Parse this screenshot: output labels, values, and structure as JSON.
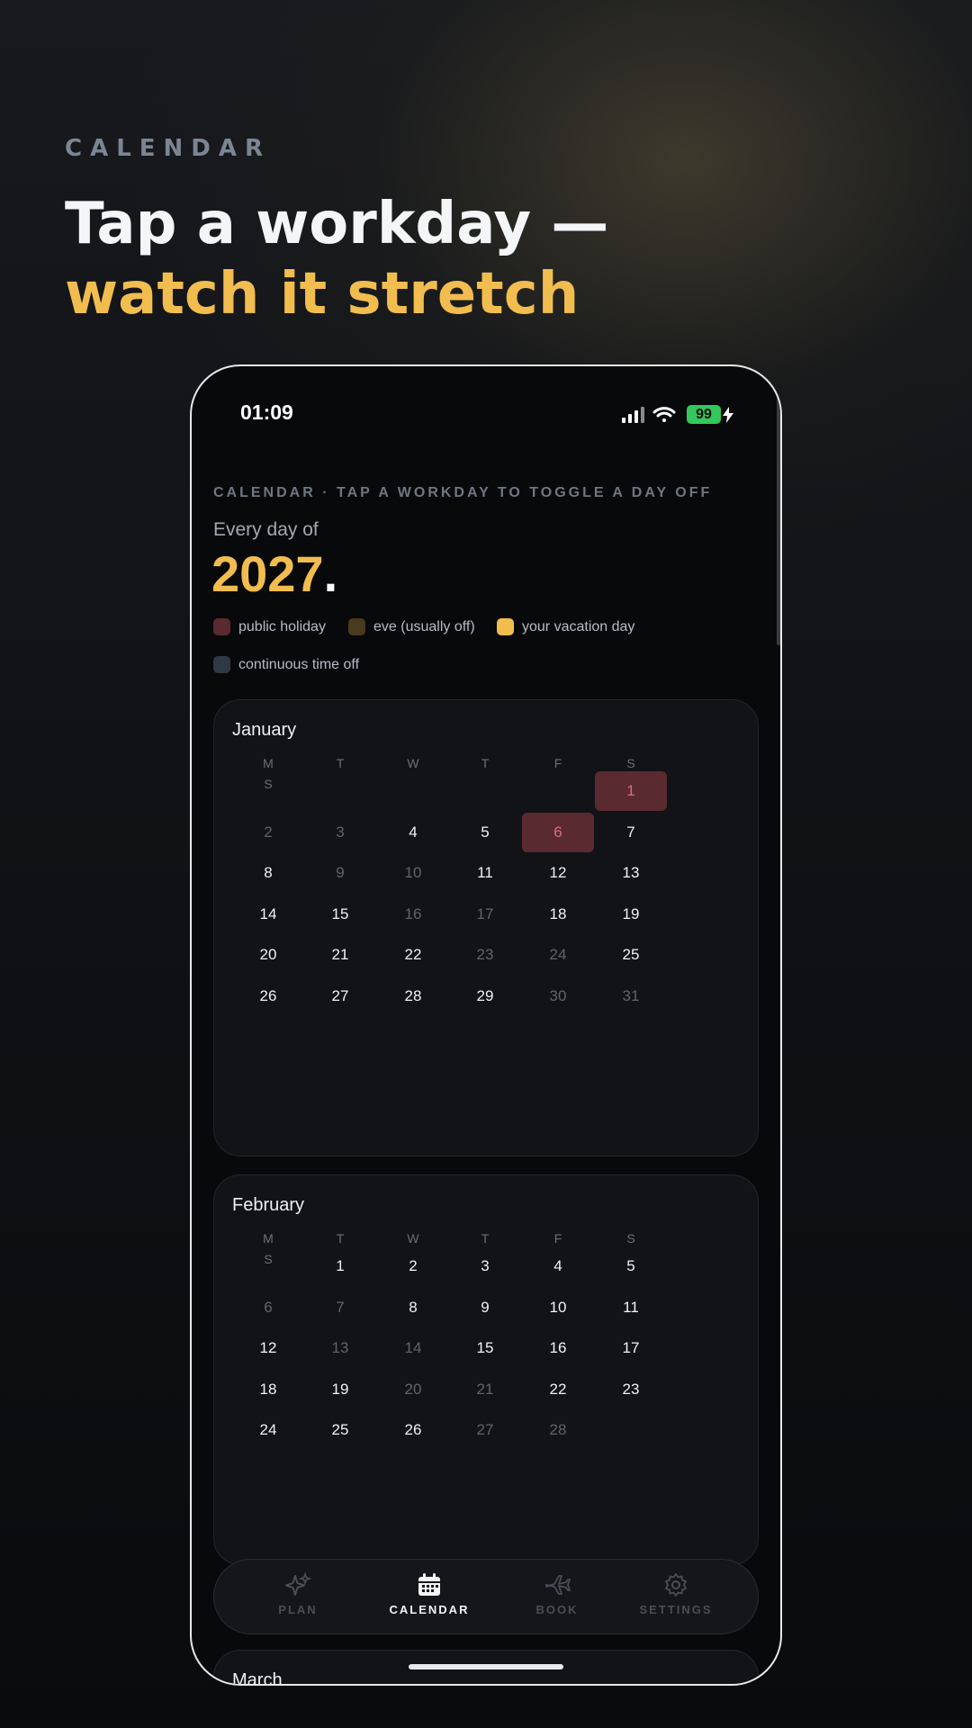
{
  "hero": {
    "eyebrow": "CALENDAR",
    "title_line1": "Tap a workday —",
    "title_line2": "watch it stretch"
  },
  "status_bar": {
    "time": "01:09",
    "battery": "99",
    "icons": [
      "signal-icon",
      "wifi-icon",
      "battery-icon",
      "charging-icon"
    ]
  },
  "screen": {
    "kicker": "CALENDAR · TAP A WORKDAY TO TOGGLE A DAY OFF",
    "subtitle": "Every day of",
    "year": "2027",
    "year_dot": "."
  },
  "legend": [
    {
      "label": "public holiday",
      "color": "#5a2a31"
    },
    {
      "label": "eve (usually off)",
      "color": "#4a3a1e"
    },
    {
      "label": "your vacation day",
      "color": "#f1bd4f"
    },
    {
      "label": "continuous time off",
      "color": "#2f3945"
    }
  ],
  "weekdays": [
    "M",
    "T",
    "W",
    "T",
    "F",
    "S",
    "S"
  ],
  "months": [
    {
      "name": "January",
      "weeks": [
        [
          null,
          null,
          null,
          null,
          null,
          {
            "d": "1",
            "s": "holiday"
          },
          null
        ],
        [
          {
            "d": "2",
            "s": "muted"
          },
          {
            "d": "3",
            "s": "muted"
          },
          {
            "d": "4"
          },
          {
            "d": "5"
          },
          {
            "d": "6",
            "s": "holiday"
          },
          {
            "d": "7"
          },
          null
        ],
        [
          {
            "d": "8"
          },
          {
            "d": "9",
            "s": "muted"
          },
          {
            "d": "10",
            "s": "muted"
          },
          {
            "d": "11"
          },
          {
            "d": "12"
          },
          {
            "d": "13"
          },
          null
        ],
        [
          {
            "d": "14"
          },
          {
            "d": "15"
          },
          {
            "d": "16",
            "s": "muted"
          },
          {
            "d": "17",
            "s": "muted"
          },
          {
            "d": "18"
          },
          {
            "d": "19"
          },
          null
        ],
        [
          {
            "d": "20"
          },
          {
            "d": "21"
          },
          {
            "d": "22"
          },
          {
            "d": "23",
            "s": "muted"
          },
          {
            "d": "24",
            "s": "muted"
          },
          {
            "d": "25"
          },
          null
        ],
        [
          {
            "d": "26"
          },
          {
            "d": "27"
          },
          {
            "d": "28"
          },
          {
            "d": "29"
          },
          {
            "d": "30",
            "s": "muted"
          },
          {
            "d": "31",
            "s": "muted"
          },
          null
        ]
      ]
    },
    {
      "name": "February",
      "weeks": [
        [
          null,
          {
            "d": "1"
          },
          {
            "d": "2"
          },
          {
            "d": "3"
          },
          {
            "d": "4"
          },
          {
            "d": "5"
          },
          null
        ],
        [
          {
            "d": "6",
            "s": "muted"
          },
          {
            "d": "7",
            "s": "muted"
          },
          {
            "d": "8"
          },
          {
            "d": "9"
          },
          {
            "d": "10"
          },
          {
            "d": "11"
          },
          null
        ],
        [
          {
            "d": "12"
          },
          {
            "d": "13",
            "s": "muted"
          },
          {
            "d": "14",
            "s": "muted"
          },
          {
            "d": "15"
          },
          {
            "d": "16"
          },
          {
            "d": "17"
          },
          null
        ],
        [
          {
            "d": "18"
          },
          {
            "d": "19"
          },
          {
            "d": "20",
            "s": "muted"
          },
          {
            "d": "21",
            "s": "muted"
          },
          {
            "d": "22"
          },
          {
            "d": "23"
          },
          null
        ],
        [
          {
            "d": "24"
          },
          {
            "d": "25"
          },
          {
            "d": "26"
          },
          {
            "d": "27",
            "s": "muted"
          },
          {
            "d": "28",
            "s": "muted"
          },
          null,
          null
        ]
      ]
    },
    {
      "name": "March",
      "weeks": []
    }
  ],
  "tabs": [
    {
      "label": "PLAN",
      "icon": "sparkles-icon",
      "active": false
    },
    {
      "label": "CALENDAR",
      "icon": "calendar-icon",
      "active": true
    },
    {
      "label": "BOOK",
      "icon": "airplane-icon",
      "active": false
    },
    {
      "label": "SETTINGS",
      "icon": "gear-icon",
      "active": false
    }
  ]
}
